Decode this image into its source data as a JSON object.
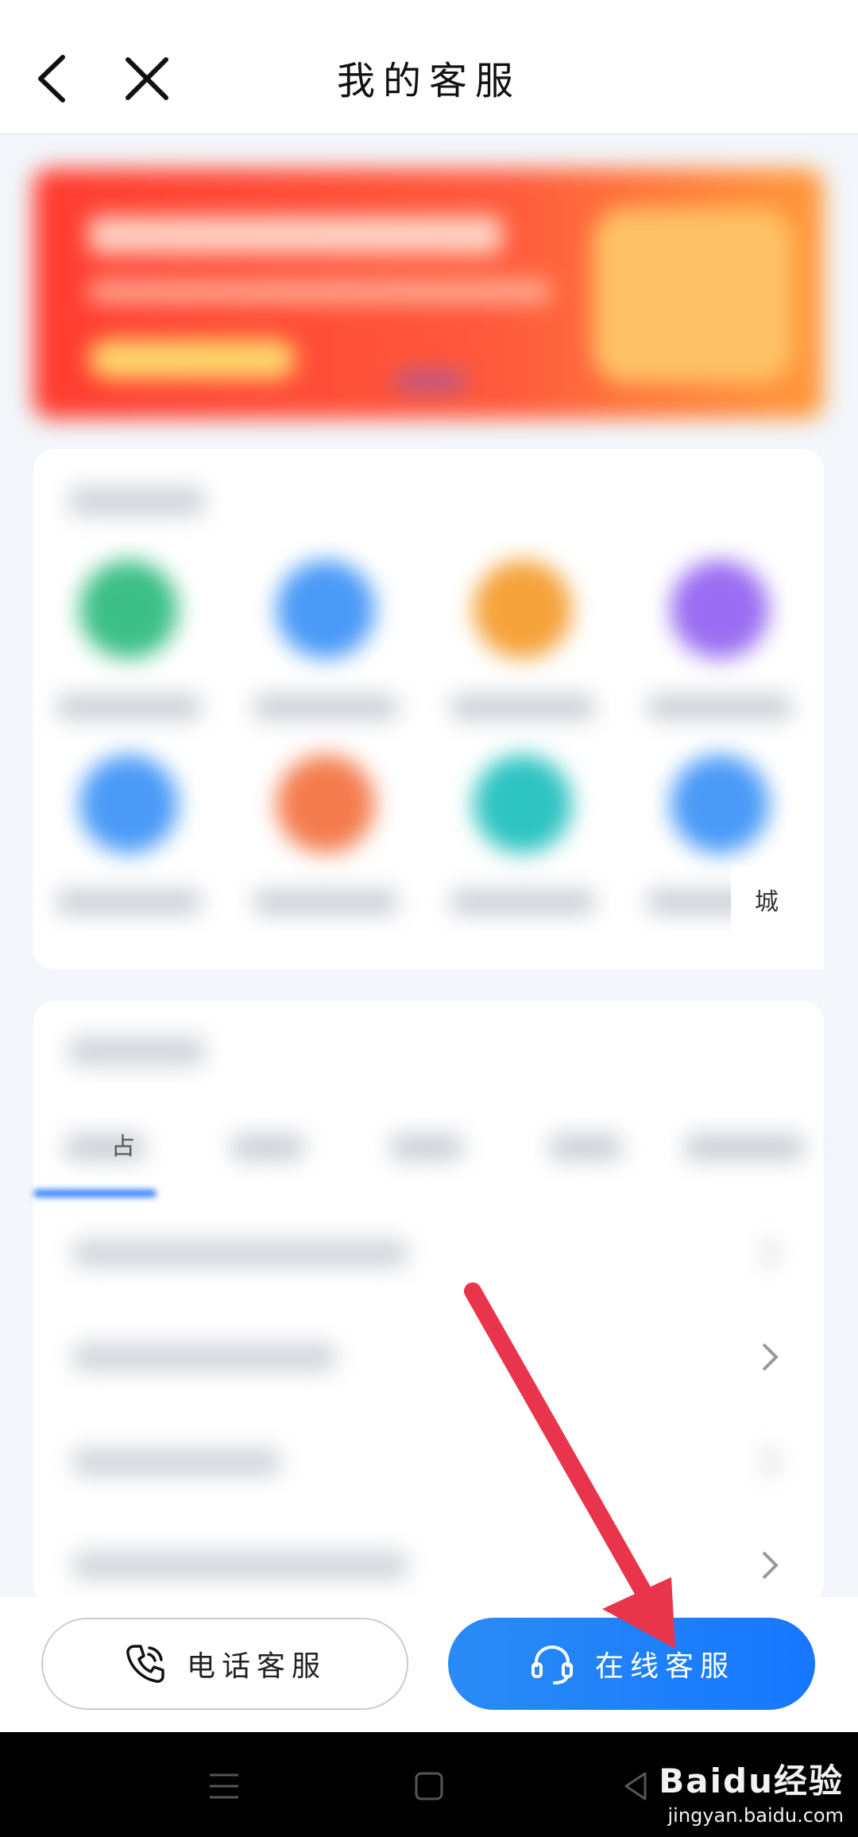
{
  "header": {
    "title": "我的客服",
    "back_icon": "chevron-left-icon",
    "close_icon": "close-icon"
  },
  "service_grid": {
    "circle_colors": [
      "#3cbf86",
      "#4a9af7",
      "#f5a23a",
      "#9a6ef2",
      "#4a9af7",
      "#f47c4e",
      "#2ec4c2",
      "#4a9af7"
    ],
    "edge_char": "城"
  },
  "faq": {
    "first_tab_partial": "占"
  },
  "bottom_buttons": {
    "phone_label": "电话客服",
    "phone_icon": "phone-icon",
    "online_label": "在线客服",
    "online_icon": "headset-icon"
  },
  "colors": {
    "accent_blue": "#1677ff",
    "annotation_arrow": "#e8354b"
  },
  "watermark": {
    "main": "Baidu经验",
    "sub": "jingyan.baidu.com"
  }
}
